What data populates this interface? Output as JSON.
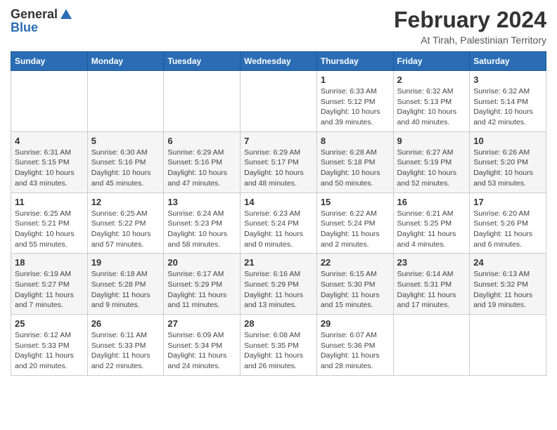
{
  "logo": {
    "general": "General",
    "blue": "Blue",
    "icon": "▶"
  },
  "title": "February 2024",
  "subtitle": "At Tirah, Palestinian Territory",
  "days_of_week": [
    "Sunday",
    "Monday",
    "Tuesday",
    "Wednesday",
    "Thursday",
    "Friday",
    "Saturday"
  ],
  "weeks": [
    [
      {
        "day": "",
        "info": ""
      },
      {
        "day": "",
        "info": ""
      },
      {
        "day": "",
        "info": ""
      },
      {
        "day": "",
        "info": ""
      },
      {
        "day": "1",
        "info": "Sunrise: 6:33 AM\nSunset: 5:12 PM\nDaylight: 10 hours\nand 39 minutes."
      },
      {
        "day": "2",
        "info": "Sunrise: 6:32 AM\nSunset: 5:13 PM\nDaylight: 10 hours\nand 40 minutes."
      },
      {
        "day": "3",
        "info": "Sunrise: 6:32 AM\nSunset: 5:14 PM\nDaylight: 10 hours\nand 42 minutes."
      }
    ],
    [
      {
        "day": "4",
        "info": "Sunrise: 6:31 AM\nSunset: 5:15 PM\nDaylight: 10 hours\nand 43 minutes."
      },
      {
        "day": "5",
        "info": "Sunrise: 6:30 AM\nSunset: 5:16 PM\nDaylight: 10 hours\nand 45 minutes."
      },
      {
        "day": "6",
        "info": "Sunrise: 6:29 AM\nSunset: 5:16 PM\nDaylight: 10 hours\nand 47 minutes."
      },
      {
        "day": "7",
        "info": "Sunrise: 6:29 AM\nSunset: 5:17 PM\nDaylight: 10 hours\nand 48 minutes."
      },
      {
        "day": "8",
        "info": "Sunrise: 6:28 AM\nSunset: 5:18 PM\nDaylight: 10 hours\nand 50 minutes."
      },
      {
        "day": "9",
        "info": "Sunrise: 6:27 AM\nSunset: 5:19 PM\nDaylight: 10 hours\nand 52 minutes."
      },
      {
        "day": "10",
        "info": "Sunrise: 6:26 AM\nSunset: 5:20 PM\nDaylight: 10 hours\nand 53 minutes."
      }
    ],
    [
      {
        "day": "11",
        "info": "Sunrise: 6:25 AM\nSunset: 5:21 PM\nDaylight: 10 hours\nand 55 minutes."
      },
      {
        "day": "12",
        "info": "Sunrise: 6:25 AM\nSunset: 5:22 PM\nDaylight: 10 hours\nand 57 minutes."
      },
      {
        "day": "13",
        "info": "Sunrise: 6:24 AM\nSunset: 5:23 PM\nDaylight: 10 hours\nand 58 minutes."
      },
      {
        "day": "14",
        "info": "Sunrise: 6:23 AM\nSunset: 5:24 PM\nDaylight: 11 hours\nand 0 minutes."
      },
      {
        "day": "15",
        "info": "Sunrise: 6:22 AM\nSunset: 5:24 PM\nDaylight: 11 hours\nand 2 minutes."
      },
      {
        "day": "16",
        "info": "Sunrise: 6:21 AM\nSunset: 5:25 PM\nDaylight: 11 hours\nand 4 minutes."
      },
      {
        "day": "17",
        "info": "Sunrise: 6:20 AM\nSunset: 5:26 PM\nDaylight: 11 hours\nand 6 minutes."
      }
    ],
    [
      {
        "day": "18",
        "info": "Sunrise: 6:19 AM\nSunset: 5:27 PM\nDaylight: 11 hours\nand 7 minutes."
      },
      {
        "day": "19",
        "info": "Sunrise: 6:18 AM\nSunset: 5:28 PM\nDaylight: 11 hours\nand 9 minutes."
      },
      {
        "day": "20",
        "info": "Sunrise: 6:17 AM\nSunset: 5:29 PM\nDaylight: 11 hours\nand 11 minutes."
      },
      {
        "day": "21",
        "info": "Sunrise: 6:16 AM\nSunset: 5:29 PM\nDaylight: 11 hours\nand 13 minutes."
      },
      {
        "day": "22",
        "info": "Sunrise: 6:15 AM\nSunset: 5:30 PM\nDaylight: 11 hours\nand 15 minutes."
      },
      {
        "day": "23",
        "info": "Sunrise: 6:14 AM\nSunset: 5:31 PM\nDaylight: 11 hours\nand 17 minutes."
      },
      {
        "day": "24",
        "info": "Sunrise: 6:13 AM\nSunset: 5:32 PM\nDaylight: 11 hours\nand 19 minutes."
      }
    ],
    [
      {
        "day": "25",
        "info": "Sunrise: 6:12 AM\nSunset: 5:33 PM\nDaylight: 11 hours\nand 20 minutes."
      },
      {
        "day": "26",
        "info": "Sunrise: 6:11 AM\nSunset: 5:33 PM\nDaylight: 11 hours\nand 22 minutes."
      },
      {
        "day": "27",
        "info": "Sunrise: 6:09 AM\nSunset: 5:34 PM\nDaylight: 11 hours\nand 24 minutes."
      },
      {
        "day": "28",
        "info": "Sunrise: 6:08 AM\nSunset: 5:35 PM\nDaylight: 11 hours\nand 26 minutes."
      },
      {
        "day": "29",
        "info": "Sunrise: 6:07 AM\nSunset: 5:36 PM\nDaylight: 11 hours\nand 28 minutes."
      },
      {
        "day": "",
        "info": ""
      },
      {
        "day": "",
        "info": ""
      }
    ]
  ]
}
